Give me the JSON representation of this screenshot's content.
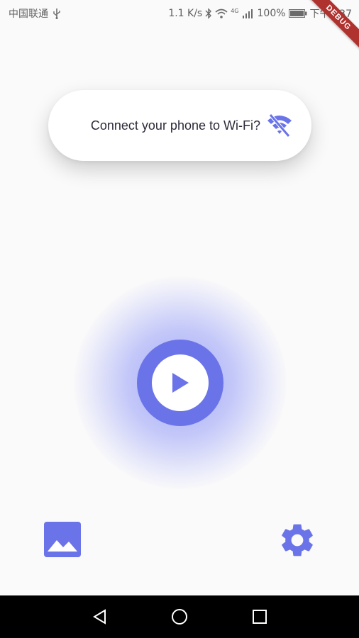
{
  "status_bar": {
    "carrier": "中国联通",
    "network_speed": "1.1 K/s",
    "signal_label": "4G",
    "battery_percent": "100%",
    "time": "下午2:37"
  },
  "debug_banner": "DEBUG",
  "wifi_prompt": {
    "text": "Connect your phone to Wi-Fi?",
    "icon": "wifi-off-icon"
  },
  "play_button": {
    "icon": "play-icon"
  },
  "actions": {
    "gallery_icon": "image-icon",
    "settings_icon": "gear-icon"
  },
  "colors": {
    "accent": "#6a74e8",
    "glow": "#5c68f6",
    "background": "#fafafa",
    "debug_ribbon": "#b0322f"
  },
  "nav": {
    "back_icon": "back-triangle-icon",
    "home_icon": "home-circle-icon",
    "recents_icon": "recents-square-icon"
  }
}
